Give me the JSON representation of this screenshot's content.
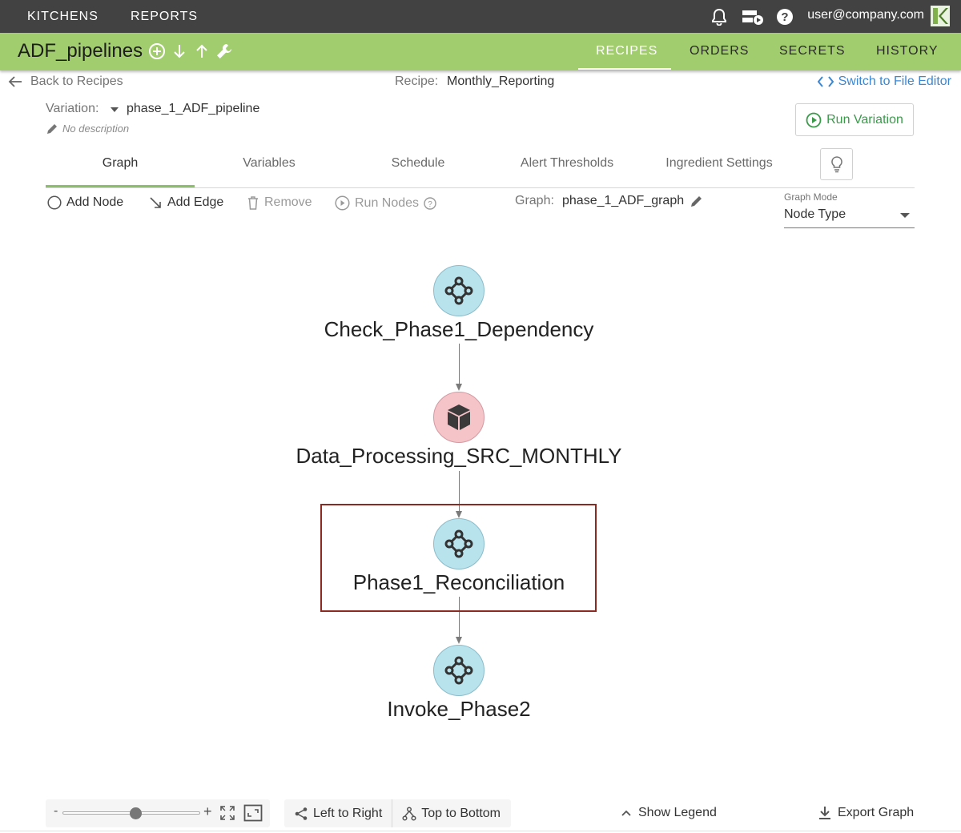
{
  "topbar": {
    "nav": [
      "KITCHENS",
      "REPORTS"
    ],
    "user": "user@company.com"
  },
  "recipe_bar": {
    "title": "ADF_pipelines",
    "tabs": [
      "RECIPES",
      "ORDERS",
      "SECRETS",
      "HISTORY"
    ],
    "active_tab": "RECIPES"
  },
  "subheader": {
    "back": "Back to Recipes",
    "recipe_label": "Recipe:",
    "recipe_value": "Monthly_Reporting",
    "switch": "Switch to File Editor",
    "variation_label": "Variation:",
    "variation_value": "phase_1_ADF_pipeline",
    "description": "No description",
    "run_variation": "Run Variation"
  },
  "tabs": [
    "Graph",
    "Variables",
    "Schedule",
    "Alert Thresholds",
    "Ingredient Settings"
  ],
  "toolbar": {
    "add_node": "Add Node",
    "add_edge": "Add Edge",
    "remove": "Remove",
    "run_nodes": "Run Nodes",
    "graph_label": "Graph:",
    "graph_value": "phase_1_ADF_graph",
    "graph_mode_label": "Graph Mode",
    "graph_mode_value": "Node Type"
  },
  "graph": {
    "nodes": [
      {
        "label": "Check_Phase1_Dependency",
        "type": "pipeline",
        "color": "#b9e3ec"
      },
      {
        "label": "Data_Processing_SRC_MONTHLY",
        "type": "container",
        "color": "#f4c4c9"
      },
      {
        "label": "Phase1_Reconciliation",
        "type": "pipeline",
        "color": "#b9e3ec",
        "selected": true
      },
      {
        "label": "Invoke_Phase2",
        "type": "pipeline",
        "color": "#b9e3ec"
      }
    ]
  },
  "bottom": {
    "zoom_minus": "-",
    "zoom_plus": "+",
    "left_to_right": "Left to Right",
    "top_to_bottom": "Top to Bottom",
    "show_legend": "Show Legend",
    "export_graph": "Export Graph"
  },
  "colors": {
    "topbar": "#424242",
    "recipe_bar": "#a2cd6f",
    "accent_link": "#3b87d1",
    "run_green": "#3a9a4a",
    "selection": "#8a2a23"
  }
}
